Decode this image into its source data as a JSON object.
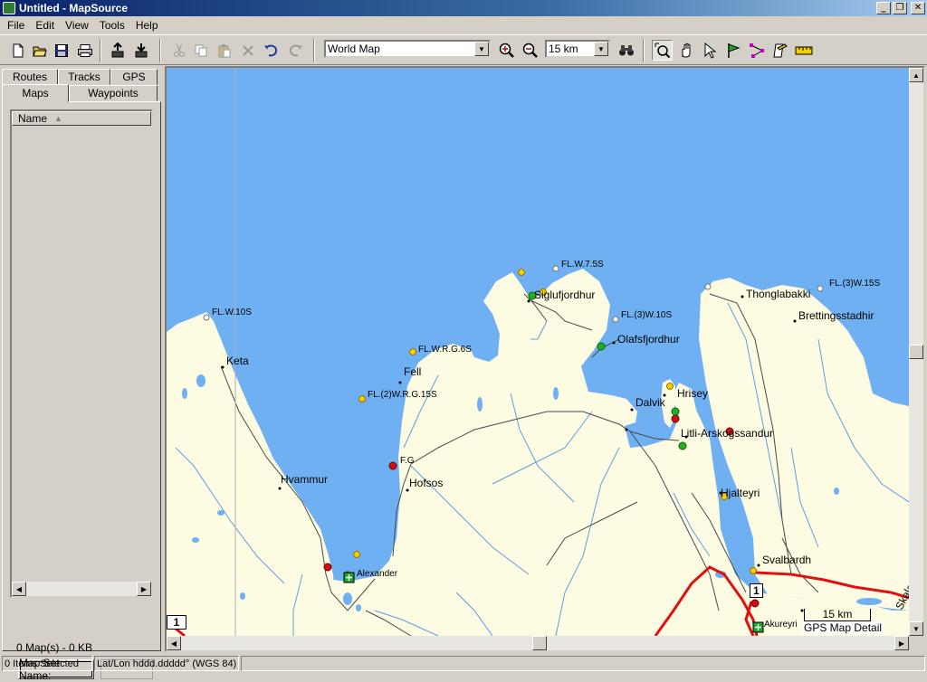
{
  "window": {
    "title": "Untitled - MapSource",
    "minimize": "_",
    "restore": "❐",
    "close": "✕"
  },
  "menu": [
    "File",
    "Edit",
    "View",
    "Tools",
    "Help"
  ],
  "toolbar": {
    "map_product": "World Map",
    "zoom_level": "15 km"
  },
  "left_panel": {
    "tabs_top": [
      "Routes",
      "Tracks",
      "GPS"
    ],
    "tabs_bottom": [
      "Maps",
      "Waypoints"
    ],
    "active_tab": "Maps",
    "list_header": "Name",
    "sort_indicator": "▲",
    "summary": "0 Map(s) - 0 KB",
    "mapset_button": "Map Set Name:"
  },
  "map": {
    "places": [
      "Keta",
      "Fell",
      "Hvammur",
      "Hofsos",
      "Alexander",
      "Siglufjordhur",
      "Olafsfjordhur",
      "Dalvik",
      "Hrisey",
      "Litli-Arskogssandur",
      "Hjalteyri",
      "Thonglabakki",
      "Brettingsstadhir",
      "Svalbardh",
      "Akureyri",
      "Skala"
    ],
    "lights": [
      "FL.W.10S",
      "FL.W.R.G.6S",
      "FL.(2)W.R.G.15S",
      "F.G",
      "FL.W.7.5S",
      "FL.(3)W.10S",
      "FL.(3)W.15S"
    ],
    "road_shield": "1",
    "scale_label": "15 km",
    "detail_label": "GPS Map Detail",
    "colors": {
      "water": "#6fb0f2",
      "land": "#fdfbe1",
      "river": "#5a9fe5",
      "road": "#e01010"
    }
  },
  "status": {
    "selection": "0 Items Selected",
    "position_format": "Lat/Lon hddd.ddddd° (WGS 84)"
  }
}
